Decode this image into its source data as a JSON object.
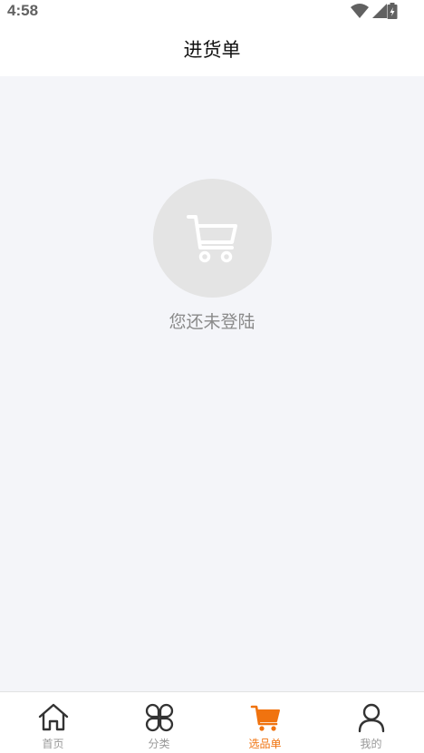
{
  "status_bar": {
    "time": "4:58"
  },
  "header": {
    "title": "进货单"
  },
  "empty_state": {
    "icon": "shopping-cart-icon",
    "message": "您还未登陆"
  },
  "tabbar": {
    "active_color": "#f0730f",
    "inactive_color": "#999999",
    "items": [
      {
        "label": "首页",
        "icon": "home-icon"
      },
      {
        "label": "分类",
        "icon": "category-icon"
      },
      {
        "label": "选品单",
        "icon": "cart-icon",
        "active": true
      },
      {
        "label": "我的",
        "icon": "user-icon"
      }
    ]
  }
}
